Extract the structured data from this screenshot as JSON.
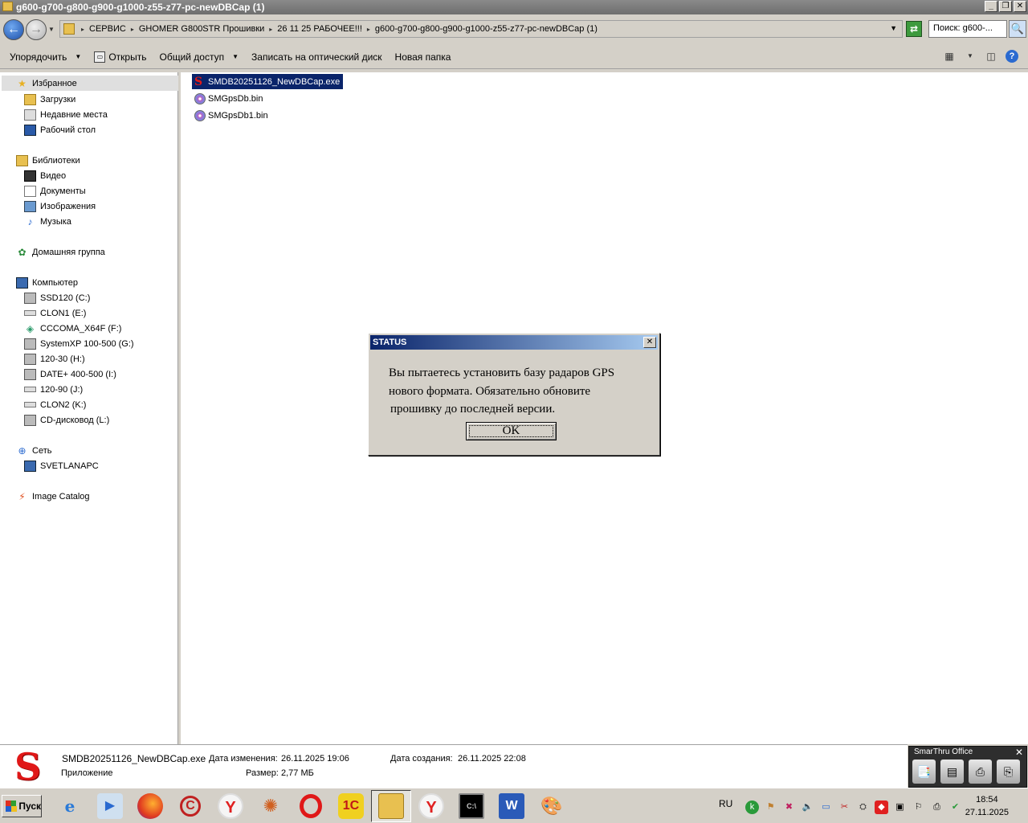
{
  "window": {
    "title": "g600-g700-g800-g900-g1000-z55-z77-pc-newDBCap (1)"
  },
  "address": {
    "crumbs": [
      "СЕРВИС",
      "GHOMER G800STR Прошивки",
      "26 11 25 РАБОЧЕЕ!!!",
      "g600-g700-g800-g900-g1000-z55-z77-pc-newDBCap (1)"
    ],
    "search_value": "Поиск: g600-..."
  },
  "toolbar": {
    "organize": "Упорядочить",
    "open": "Открыть",
    "share": "Общий доступ",
    "burn": "Записать на оптический диск",
    "new_folder": "Новая папка"
  },
  "sidebar": {
    "favorites": "Избранное",
    "downloads": "Загрузки",
    "recent": "Недавние места",
    "desktop": "Рабочий стол",
    "libraries": "Библиотеки",
    "video": "Видео",
    "documents": "Документы",
    "pictures": "Изображения",
    "music": "Музыка",
    "homegroup": "Домашняя группа",
    "computer": "Компьютер",
    "drives": [
      "SSD120 (C:)",
      "CLON1 (E:)",
      "CCCOMA_X64F (F:)",
      "SystemXP 100-500 (G:)",
      "120-30 (H:)",
      "DATE+ 400-500 (I:)",
      "120-90 (J:)",
      "CLON2 (K:)",
      "CD-дисковод (L:)"
    ],
    "network": "Сеть",
    "network_pc": "SVETLANAPC",
    "image_catalog": "Image Catalog"
  },
  "files": [
    "SMDB20251126_NewDBCap.exe",
    "SMGpsDb.bin",
    "SMGpsDb1.bin"
  ],
  "dialog": {
    "title": "STATUS",
    "message_line1": "Вы пытаетесь установить базу радаров GPS",
    "message_line2": "нового формата. Обязательно обновите",
    "message_line3": "прошивку до последней версии.",
    "ok": "OK"
  },
  "details": {
    "name": "SMDB20251126_NewDBCap.exe",
    "type": "Приложение",
    "modified_label": "Дата изменения:",
    "modified_value": "26.11.2025 19:06",
    "created_label": "Дата создания:",
    "created_value": "26.11.2025 22:08",
    "size_label": "Размер:",
    "size_value": "2,77 МБ"
  },
  "smarthru": {
    "title": "SmarThru Office"
  },
  "taskbar": {
    "start": "Пуск",
    "lang": "RU",
    "time": "18:54",
    "date": "27.11.2025"
  }
}
